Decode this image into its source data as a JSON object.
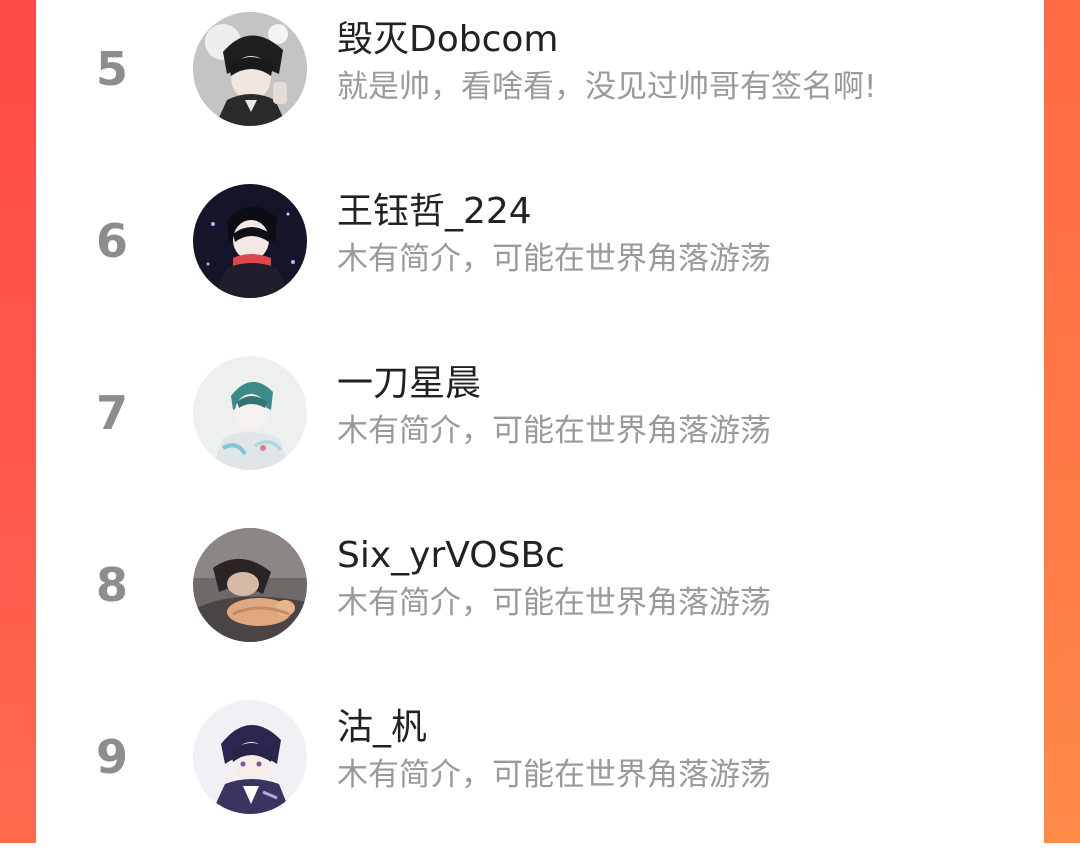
{
  "leaderboard": {
    "rows": [
      {
        "rank": "5",
        "name": "毁灭Dobcom",
        "bio": "就是帅，看啥看，没见过帅哥有签名啊!",
        "avatar_icon": "anime-boy-avatar"
      },
      {
        "rank": "6",
        "name": "王钰哲_224",
        "bio": "木有简介，可能在世界角落游荡",
        "avatar_icon": "anime-boy-scarf-avatar"
      },
      {
        "rank": "7",
        "name": "一刀星晨",
        "bio": "木有简介，可能在世界角落游荡",
        "avatar_icon": "sketch-boy-avatar"
      },
      {
        "rank": "8",
        "name": "Six_yrVOSBc",
        "bio": "木有简介，可能在世界角落游荡",
        "avatar_icon": "person-with-cat-avatar"
      },
      {
        "rank": "9",
        "name": "沽_杋",
        "bio": "木有简介，可能在世界角落游荡",
        "avatar_icon": "anime-boy-purple-avatar"
      }
    ]
  },
  "colors": {
    "accent_left": "#ff4a45",
    "accent_right": "#ff7a45",
    "rank_text": "#8d8d8d",
    "name_text": "#222222",
    "bio_text": "#9a9a9a"
  }
}
